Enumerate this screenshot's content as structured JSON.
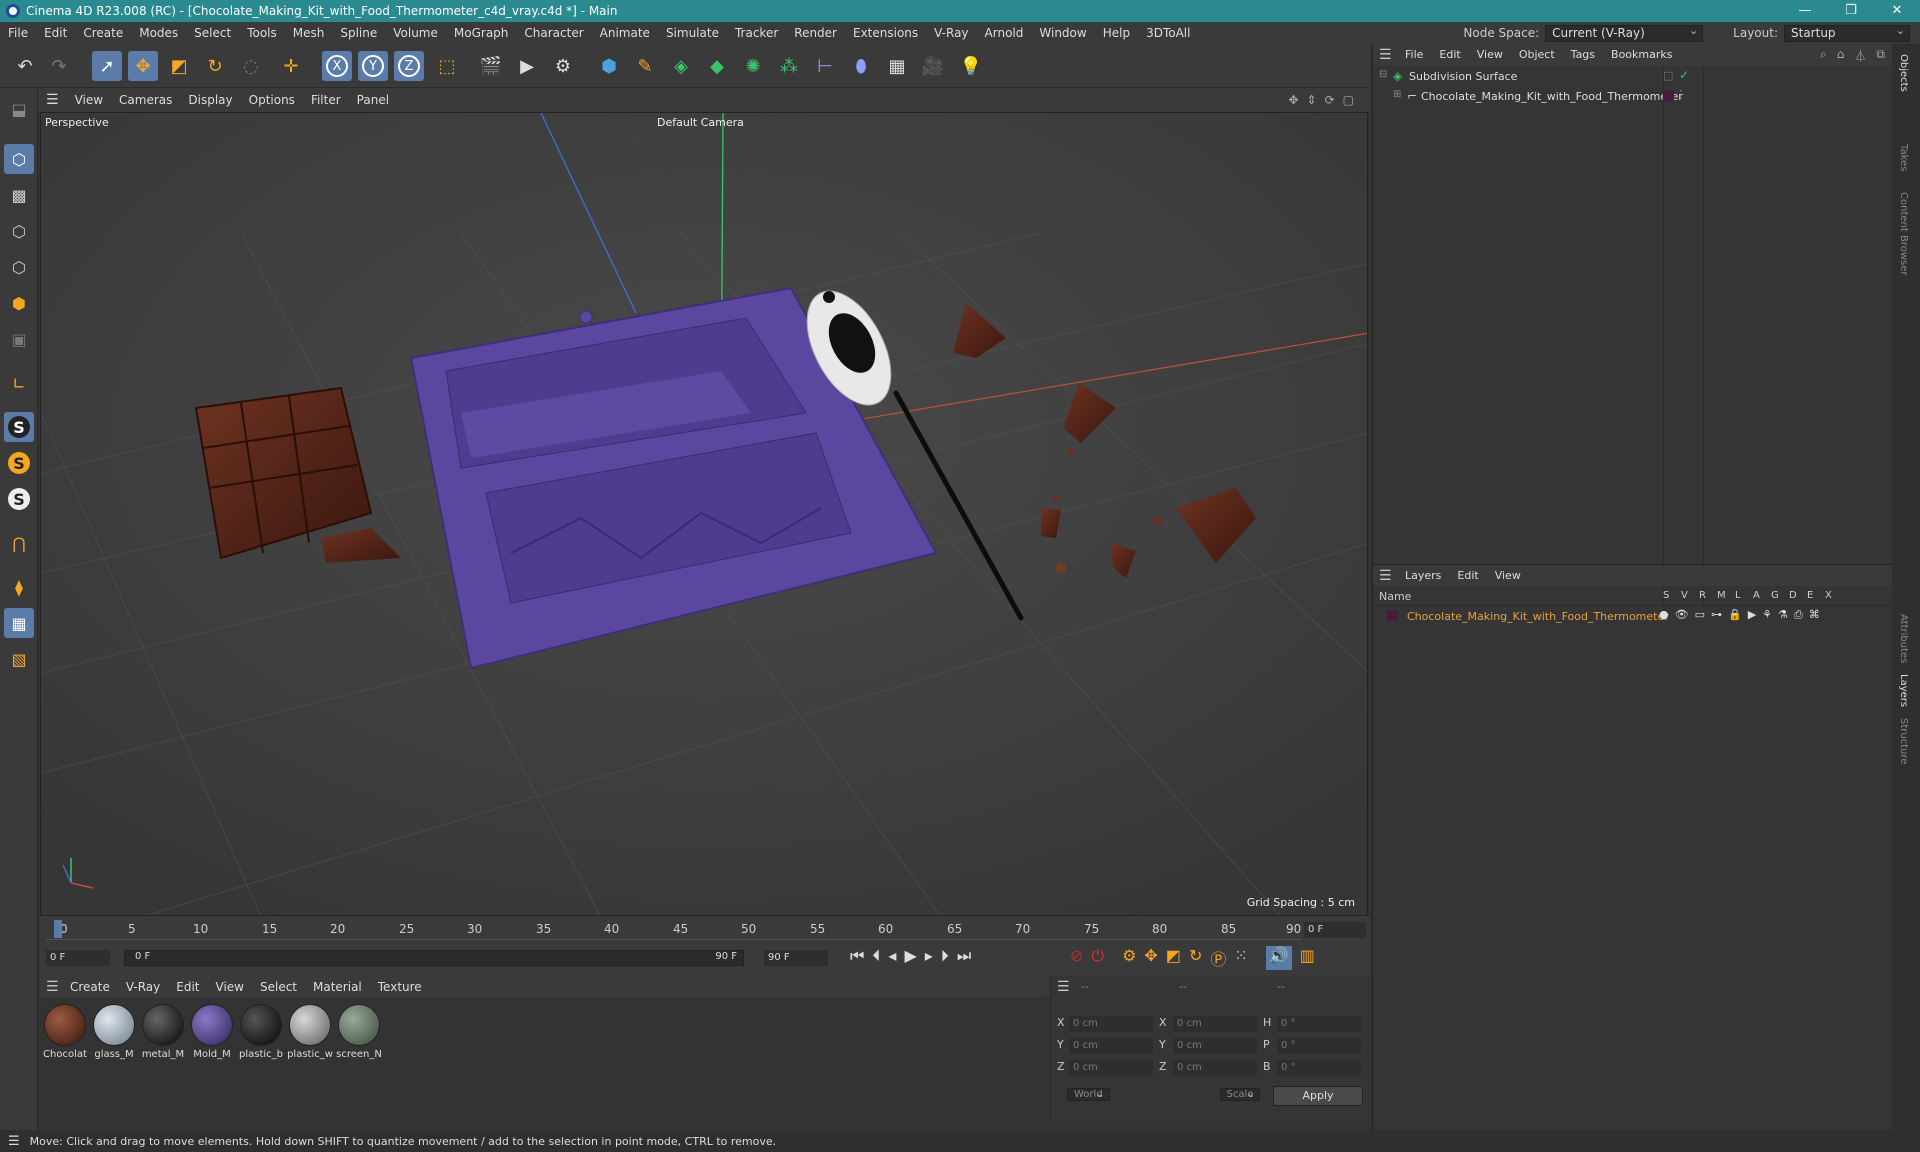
{
  "titlebar": {
    "title": "Cinema 4D R23.008 (RC) - [Chocolate_Making_Kit_with_Food_Thermometer_c4d_vray.c4d *] - Main"
  },
  "menu": [
    "File",
    "Edit",
    "Create",
    "Modes",
    "Select",
    "Tools",
    "Mesh",
    "Spline",
    "Volume",
    "MoGraph",
    "Character",
    "Animate",
    "Simulate",
    "Tracker",
    "Render",
    "Extensions",
    "V-Ray",
    "Arnold",
    "Window",
    "Help",
    "3DToAll"
  ],
  "nodespace": {
    "label": "Node Space:",
    "value": "Current (V-Ray)"
  },
  "layout": {
    "label": "Layout:",
    "value": "Startup"
  },
  "viewport_menu": [
    "View",
    "Cameras",
    "Display",
    "Options",
    "Filter",
    "Panel"
  ],
  "viewport": {
    "name": "Perspective",
    "camera": "Default Camera",
    "grid_spacing": "Grid Spacing : 5 cm"
  },
  "timeline": {
    "ticks": [
      "0",
      "5",
      "10",
      "15",
      "20",
      "25",
      "30",
      "35",
      "40",
      "45",
      "50",
      "55",
      "60",
      "65",
      "70",
      "75",
      "80",
      "85",
      "90"
    ],
    "end_frame_display": "0 F",
    "current_frame": "0 F",
    "range_start": "0 F",
    "range_end": "90 F",
    "max_frame": "90 F"
  },
  "material_menu": [
    "Create",
    "V-Ray",
    "Edit",
    "View",
    "Select",
    "Material",
    "Texture"
  ],
  "materials": [
    {
      "label": "Chocolat",
      "color": "#5a2a1c"
    },
    {
      "label": "glass_M",
      "color": "#8e9aa8"
    },
    {
      "label": "metal_M",
      "color": "#111111"
    },
    {
      "label": "Mold_M",
      "color": "#4b3a7a"
    },
    {
      "label": "plastic_b",
      "color": "#151515"
    },
    {
      "label": "plastic_w",
      "color": "#8a8a8a"
    },
    {
      "label": "screen_N",
      "color": "#5a6a5a"
    }
  ],
  "coords": {
    "headers": [
      "--",
      "--",
      "--"
    ],
    "rows": [
      {
        "a": "X",
        "av": "0 cm",
        "b": "X",
        "bv": "0 cm",
        "c": "H",
        "cv": "0 °"
      },
      {
        "a": "Y",
        "av": "0 cm",
        "b": "Y",
        "bv": "0 cm",
        "c": "P",
        "cv": "0 °"
      },
      {
        "a": "Z",
        "av": "0 cm",
        "b": "Z",
        "bv": "0 cm",
        "c": "B",
        "cv": "0 °"
      }
    ],
    "world": "World",
    "scale": "Scale",
    "apply": "Apply"
  },
  "objects_menu": [
    "File",
    "Edit",
    "View",
    "Object",
    "Tags",
    "Bookmarks"
  ],
  "objects": [
    {
      "name": "Subdivision Surface"
    },
    {
      "name": "Chocolate_Making_Kit_with_Food_Thermometer"
    }
  ],
  "layers_menu": [
    "Layers",
    "Edit",
    "View"
  ],
  "layers_header": {
    "name": "Name",
    "cols": [
      "S",
      "V",
      "R",
      "M",
      "L",
      "A",
      "G",
      "D",
      "E",
      "X"
    ]
  },
  "layers": [
    {
      "name": "Chocolate_Making_Kit_with_Food_Thermometer"
    }
  ],
  "right_tabs": [
    "Objects",
    "Takes",
    "Content Browser",
    "Attributes",
    "Layers",
    "Structure"
  ],
  "status": "Move: Click and drag to move elements. Hold down SHIFT to quantize movement / add to the selection in point mode, CTRL to remove.",
  "colors": {
    "titlebar": "#2a8a8f",
    "accent": "#5b7ca8",
    "mold": "#5b47a0",
    "chocolate": "#5c2a1a",
    "layer_name": "#e8a040"
  }
}
